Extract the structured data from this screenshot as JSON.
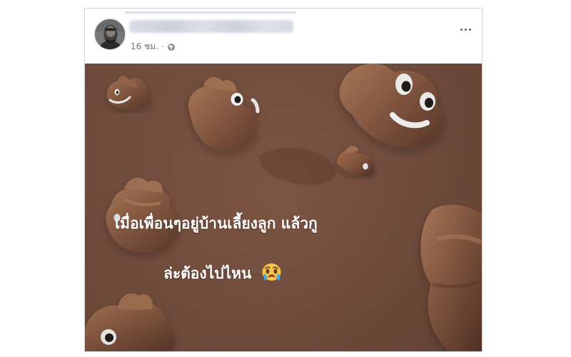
{
  "post": {
    "author": "",
    "timestamp": "16 ชม.",
    "dot": "·",
    "privacy_icon": "globe-icon",
    "more_icon": "more-icon"
  },
  "image": {
    "caption_line_1": "เมื่อเพื่อนๆอยู่บ้านเลี้ยงลูก แล้วกู",
    "caption_line_2": "ล่ะต้องไปไหน",
    "emoji": "crying-face-icon",
    "background_icon": "poop-icon",
    "colors": {
      "background": "#7a5140",
      "text": "#ffffff",
      "emoji": "#f7c34a"
    }
  }
}
